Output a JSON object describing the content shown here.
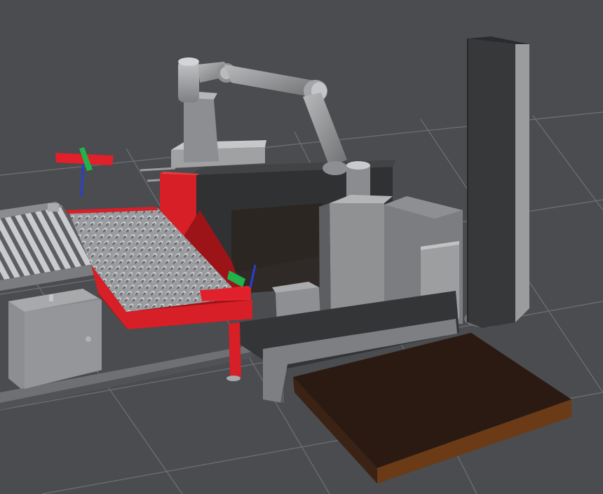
{
  "viewport": {
    "background": "#4a4c4f",
    "grid_color": "#6a6c6f"
  },
  "colors": {
    "robot_arm": "#a9abad",
    "robot_arm_shadow": "#6f7173",
    "conveyor_red": "#d61f26",
    "conveyor_red_dark": "#9c1418",
    "base_dark": "#3a3b3d",
    "panel_gray": "#8f9193",
    "tower_light": "#9a9c9e",
    "tower_dark": "#2f3032",
    "pallet": "#2b1a12",
    "pallet_edge": "#6b3a16",
    "frame_x_axis": "#e0202a",
    "frame_y_axis": "#22b24c",
    "frame_z_axis": "#2a3fcf"
  },
  "objects": [
    {
      "name": "robot-arm",
      "kind": "manipulator"
    },
    {
      "name": "roller-conveyor",
      "kind": "conveyor"
    },
    {
      "name": "ball-transfer-table",
      "kind": "conveyor"
    },
    {
      "name": "pallet",
      "kind": "pallet"
    },
    {
      "name": "robot-base-cabinet",
      "kind": "enclosure"
    },
    {
      "name": "control-cabinet",
      "kind": "enclosure"
    },
    {
      "name": "tower-column",
      "kind": "column"
    },
    {
      "name": "coordinate-frame-left",
      "kind": "tf-frame"
    },
    {
      "name": "coordinate-frame-right",
      "kind": "tf-frame"
    }
  ]
}
